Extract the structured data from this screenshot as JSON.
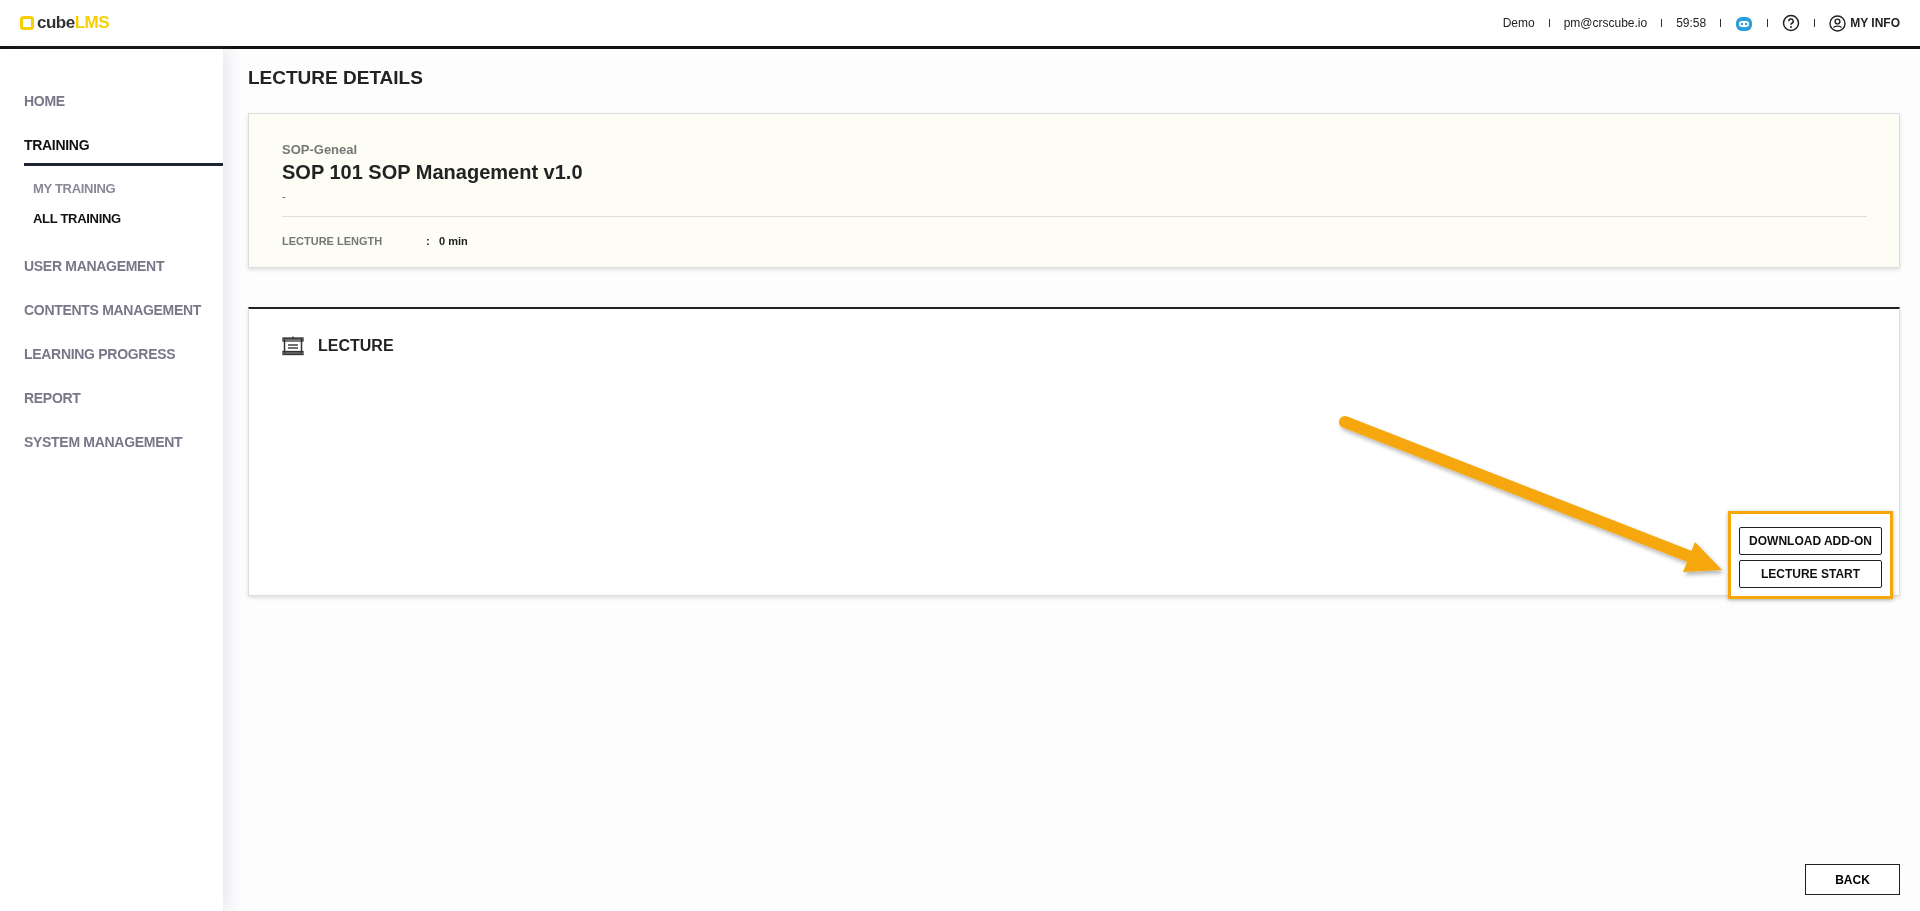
{
  "logo": {
    "text": "cube",
    "accent": "LMS"
  },
  "header": {
    "items": [
      {
        "kind": "text",
        "label": "Demo"
      },
      {
        "kind": "text",
        "label": "pm@crscube.io"
      },
      {
        "kind": "text",
        "label": "59:58"
      },
      {
        "kind": "bot"
      },
      {
        "kind": "help"
      },
      {
        "kind": "user",
        "label": "MY INFO"
      }
    ]
  },
  "sidebar": {
    "items": [
      {
        "label": "HOME",
        "selected": false
      },
      {
        "label": "TRAINING",
        "selected": true,
        "children": [
          {
            "label": "MY TRAINING",
            "selected": false
          },
          {
            "label": "ALL TRAINING",
            "selected": true
          }
        ]
      },
      {
        "label": "USER MANAGEMENT",
        "selected": false
      },
      {
        "label": "CONTENTS MANAGEMENT",
        "selected": false
      },
      {
        "label": "LEARNING PROGRESS",
        "selected": false
      },
      {
        "label": "REPORT",
        "selected": false
      },
      {
        "label": "SYSTEM MANAGEMENT",
        "selected": false
      }
    ]
  },
  "page_title": "LECTURE DETAILS",
  "summary": {
    "category": "SOP-Geneal",
    "name": "SOP 101 SOP Management v1.0",
    "description": "-",
    "fields": [
      {
        "label": "LECTURE LENGTH",
        "separator": ":",
        "value": "0 min"
      }
    ]
  },
  "lecture": {
    "title": "LECTURE",
    "buttons": [
      "DOWNLOAD ADD-ON",
      "LECTURE START"
    ]
  },
  "back_button": "BACK"
}
